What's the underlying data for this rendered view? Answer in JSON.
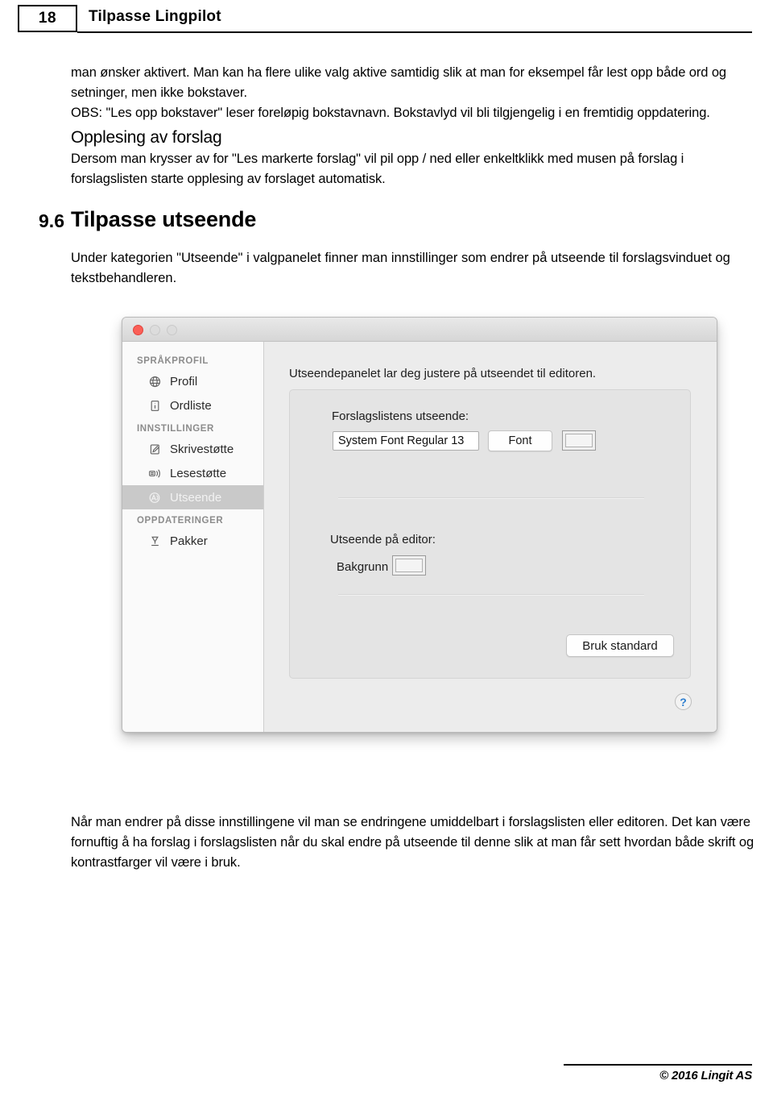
{
  "header": {
    "page_number": "18",
    "title": "Tilpasse Lingpilot"
  },
  "body": {
    "para1": "man ønsker aktivert. Man kan ha flere ulike valg aktive samtidig slik at man for eksempel får lest opp både ord og setninger, men ikke bokstaver.",
    "para2": "OBS: \"Les opp bokstaver\" leser foreløpig bokstavnavn. Bokstavlyd vil bli tilgjengelig i en fremtidig oppdatering.",
    "subheading": "Opplesing av forslag",
    "para3": "Dersom man krysser av for \"Les markerte forslag\" vil pil opp / ned eller enkeltklikk med musen på forslag i forslagslisten starte opplesing av forslaget automatisk."
  },
  "section": {
    "number": "9.6",
    "title": "Tilpasse utseende",
    "intro": "Under kategorien \"Utseende\" i valgpanelet finner man innstillinger som endrer på utseende til forslagsvinduet og tekstbehandleren."
  },
  "dialog": {
    "sidebar": {
      "groups": [
        {
          "label": "SPRÅKPROFIL",
          "items": [
            {
              "label": "Profil",
              "icon": "globe-icon",
              "selected": false
            },
            {
              "label": "Ordliste",
              "icon": "document-icon",
              "selected": false
            }
          ]
        },
        {
          "label": "INNSTILLINGER",
          "items": [
            {
              "label": "Skrivestøtte",
              "icon": "pencil-page-icon",
              "selected": false
            },
            {
              "label": "Lesestøtte",
              "icon": "speaker-icon",
              "selected": false
            },
            {
              "label": "Utseende",
              "icon": "appearance-icon",
              "selected": true
            }
          ]
        },
        {
          "label": "OPPDATERINGER",
          "items": [
            {
              "label": "Pakker",
              "icon": "download-icon",
              "selected": false
            }
          ]
        }
      ]
    },
    "pane": {
      "intro": "Utseendepanelet lar deg justere på utseendet til editoren.",
      "suggestion_label": "Forslagslistens utseende:",
      "font_value": "System Font Regular 13",
      "font_button": "Font",
      "editor_label": "Utseende på editor:",
      "background_label": "Bakgrunn",
      "default_button": "Bruk standard",
      "help_button": "?"
    },
    "window_controls": {
      "close": "close-button",
      "minimize": "minimize-button",
      "maximize": "maximize-button"
    },
    "colors": {
      "accent_close": "#fb5f57",
      "selected_row": "#c9c9c9",
      "pane_bg": "#ececec",
      "sidebar_bg": "#fafafa",
      "help_blue": "#2f7fd0"
    }
  },
  "tail": {
    "para": "Når man endrer på disse innstillingene vil man se endringene umiddelbart i forslagslisten eller editoren. Det kan være fornuftig å ha forslag i forslagslisten når du skal endre på utseende til denne slik at man får sett hvordan både skrift og kontrastfarger vil være i bruk."
  },
  "footer": {
    "copyright": "© 2016 Lingit AS"
  }
}
